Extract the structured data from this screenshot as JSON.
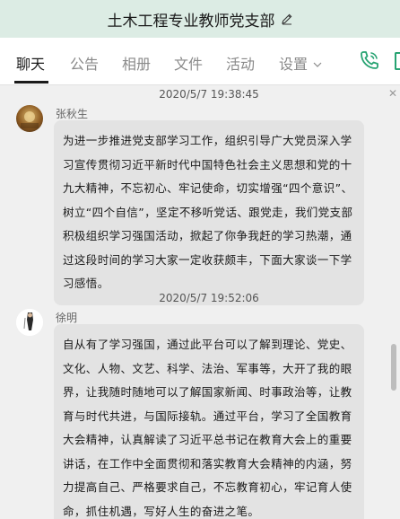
{
  "window": {
    "title": "土木工程专业教师党支部"
  },
  "tabs": [
    {
      "label": "聊天",
      "active": true
    },
    {
      "label": "公告"
    },
    {
      "label": "相册"
    },
    {
      "label": "文件"
    },
    {
      "label": "活动"
    },
    {
      "label": "设置"
    }
  ],
  "messages": [
    {
      "timestamp": "2020/5/7 19:38:45",
      "sender": "张秋生",
      "text": "为进一步推进党支部学习工作，组织引导广大党员深入学习宣传贯彻习近平新时代中国特色社会主义思想和党的十九大精神，不忘初心、牢记使命，切实增强“四个意识”、树立“四个自信”，坚定不移听党话、跟党走，我们党支部积极组织学习强国活动，掀起了你争我赶的学习热潮，通过这段时间的学习大家一定收获颇丰，下面大家谈一下学习感悟。"
    },
    {
      "timestamp": "2020/5/7 19:52:06",
      "sender": "徐明",
      "text": "自从有了学习强国，通过此平台可以了解到理论、党史、文化、人物、文艺、科学、法治、军事等，大开了我的眼界，让我随时随地可以了解国家新闻、时事政治等，让教育与时代共进，与国际接轨。通过平台，学习了全国教育大会精神，认真解读了习近平总书记在教育大会上的重要讲话，在工作中全面贯彻和落实教育大会精神的内涵，努力提高自己、严格要求自己，不忘教育初心，牢记育人使命，抓住机遇，写好人生的奋进之笔。"
    }
  ],
  "colors": {
    "titlebar_bg": "#dcece4",
    "accent": "#27a372",
    "bubble_bg": "#e3e3e3"
  }
}
